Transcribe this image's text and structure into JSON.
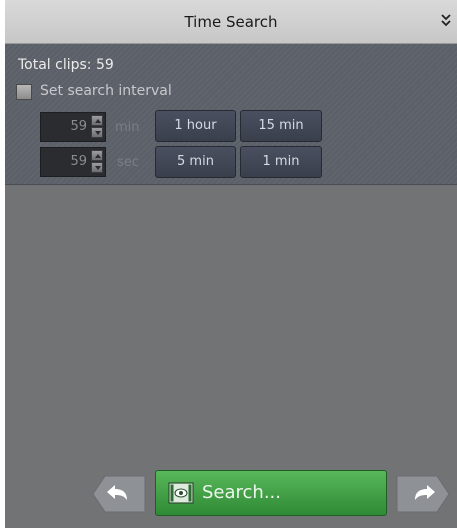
{
  "header": {
    "title": "Time Search",
    "collapse_icon": "double-chevron-down-icon"
  },
  "options": {
    "total_clips": "Total clips: 59",
    "set_interval": {
      "label": "Set search interval",
      "checked": false
    },
    "minutes": {
      "value": "59",
      "unit": "min"
    },
    "seconds": {
      "value": "59",
      "unit": "sec"
    },
    "quick_buttons": {
      "one_hour": "1 hour",
      "fifteen_min": "15 min",
      "five_min": "5 min",
      "one_min": "1 min"
    }
  },
  "footer": {
    "back_icon": "arrow-left-icon",
    "forward_icon": "arrow-right-icon",
    "search_label": "Search...",
    "search_icon": "film-eye-icon",
    "colors": {
      "search_button": "#3ea043",
      "panel_bg": "#727375",
      "options_bg": "#5c6068"
    }
  }
}
